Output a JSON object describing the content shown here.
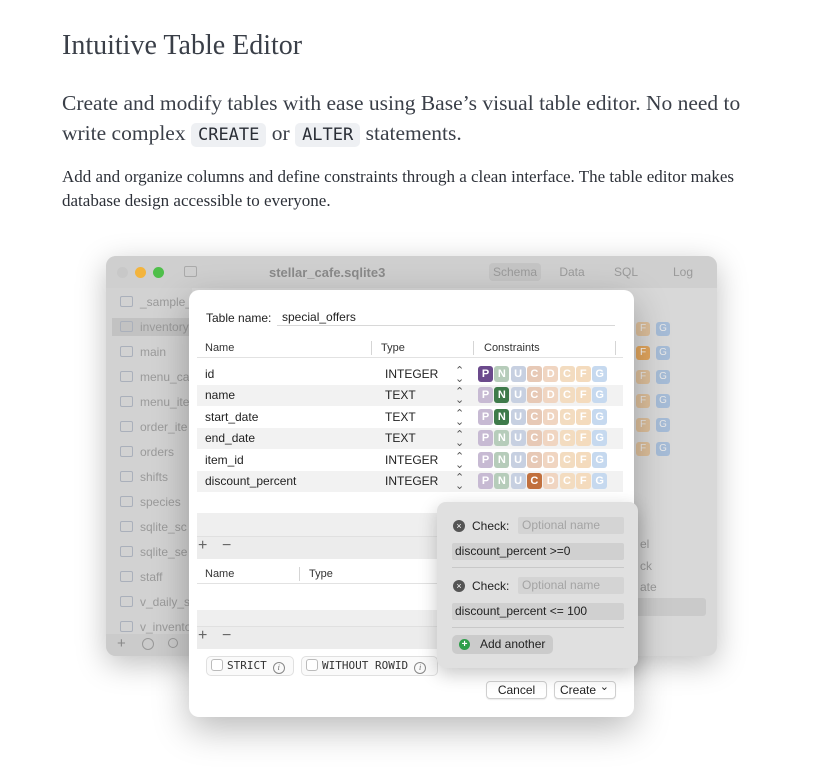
{
  "heading": "Intuitive Table Editor",
  "lead": {
    "part1": "Create and modify tables with ease using Base’s visual table editor. No need to write complex",
    "code1": "CREATE",
    "part2": "or",
    "code2": "ALTER",
    "part3": "statements."
  },
  "description": "Add and organize columns and define constraints through a clean interface. The table editor makes database design accessible to everyone.",
  "window": {
    "title": "stellar_cafe.sqlite3",
    "tabs": [
      "Schema",
      "Data",
      "SQL",
      "Log"
    ],
    "sidebar": [
      "_sample_",
      "inventory",
      "main",
      "menu_ca",
      "menu_ite",
      "order_ite",
      "orders",
      "shifts",
      "species",
      "sqlite_sc",
      "sqlite_se",
      "staff",
      "v_daily_s",
      "v_invento"
    ],
    "partial_right": [
      "el",
      "ck",
      "ate"
    ]
  },
  "dialog": {
    "table_name_label": "Table name:",
    "table_name_value": "special_offers",
    "columns_header": {
      "name": "Name",
      "type": "Type",
      "constraints": "Constraints"
    },
    "columns": [
      {
        "name": "id",
        "type": "INTEGER",
        "active": [
          "P"
        ]
      },
      {
        "name": "name",
        "type": "TEXT",
        "active": [
          "N"
        ]
      },
      {
        "name": "start_date",
        "type": "TEXT",
        "active": [
          "N"
        ]
      },
      {
        "name": "end_date",
        "type": "TEXT",
        "active": []
      },
      {
        "name": "item_id",
        "type": "INTEGER",
        "active": []
      },
      {
        "name": "discount_percent",
        "type": "INTEGER",
        "active": [
          "C"
        ]
      }
    ],
    "constraint_letters": [
      "P",
      "N",
      "U",
      "C",
      "D",
      "C",
      "F",
      "G"
    ],
    "constraint_colors": {
      "P": "#6b4a8c",
      "N": "#3e7a4a",
      "U": "#6c84b0",
      "C": "#c1703e",
      "D": "#d8905c",
      "C2": "#e0a25a",
      "F": "#e2a050",
      "G": "#6a9bd6"
    },
    "index_header": {
      "name": "Name",
      "type": "Type"
    },
    "add_symbol": "+",
    "remove_symbol": "−",
    "strict_label": "STRICT",
    "without_rowid_label": "WITHOUT ROWID",
    "info_symbol": "i",
    "cancel_label": "Cancel",
    "create_label": "Create",
    "create_chevron": "⌄"
  },
  "popover": {
    "checks": [
      {
        "label": "Check:",
        "name_placeholder": "Optional name",
        "expression": "discount_percent >=0"
      },
      {
        "label": "Check:",
        "name_placeholder": "Optional name",
        "expression": "discount_percent <= 100"
      }
    ],
    "add_another_label": "Add another",
    "remove_symbol": "×",
    "add_symbol": "+"
  }
}
